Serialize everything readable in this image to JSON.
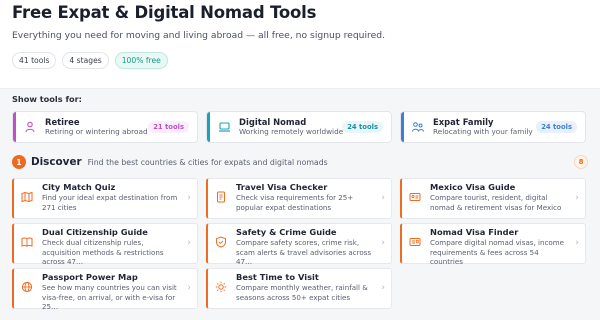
{
  "header": {
    "title": "Free Expat & Digital Nomad Tools",
    "subtitle": "Everything you need for moving and living abroad — all free, no signup required.",
    "chips": [
      "41 tools",
      "4 stages",
      "100% free"
    ]
  },
  "personas_label": "Show tools for:",
  "personas": [
    {
      "title": "Retiree",
      "subtitle": "Retiring or wintering abroad",
      "count": "21 tools",
      "icon": "person-icon",
      "color": "#c04fc8",
      "bg": "#fbeefc"
    },
    {
      "title": "Digital Nomad",
      "subtitle": "Working remotely worldwide",
      "count": "24 tools",
      "icon": "laptop-icon",
      "color": "#1aa3b8",
      "bg": "#e6f6f9"
    },
    {
      "title": "Expat Family",
      "subtitle": "Relocating with your family",
      "count": "24 tools",
      "icon": "family-icon",
      "color": "#3d7fd6",
      "bg": "#e8f0fb"
    }
  ],
  "discover": {
    "step": "1",
    "title": "Discover",
    "subtitle": "Find the best countries & cities for expats and digital nomads",
    "count": "8"
  },
  "tools": [
    {
      "title": "City Match Quiz",
      "desc": "Find your ideal expat destination from 271 cities",
      "icon": "map-icon"
    },
    {
      "title": "Travel Visa Checker",
      "desc": "Check visa requirements for 25+ popular expat destinations",
      "icon": "document-icon"
    },
    {
      "title": "Mexico Visa Guide",
      "desc": "Compare tourist, resident, digital nomad & retirement visas for Mexico",
      "icon": "id-card-icon"
    },
    {
      "title": "Dual Citizenship Guide",
      "desc": "Check dual citizenship rules, acquisition methods & restrictions across 47…",
      "icon": "book-icon"
    },
    {
      "title": "Safety & Crime Guide",
      "desc": "Compare safety scores, crime risk, scam alerts & travel advisories across 47…",
      "icon": "shield-icon"
    },
    {
      "title": "Nomad Visa Finder",
      "desc": "Compare digital nomad visas, income requirements & fees across 54 countries",
      "icon": "passport-icon"
    },
    {
      "title": "Passport Power Map",
      "desc": "See how many countries you can visit visa-free, on arrival, or with e-visa for 25…",
      "icon": "globe-icon"
    },
    {
      "title": "Best Time to Visit",
      "desc": "Compare monthly weather, rainfall & seasons across 50+ expat cities",
      "icon": "sun-icon"
    }
  ],
  "accent": "#ef6b1f"
}
